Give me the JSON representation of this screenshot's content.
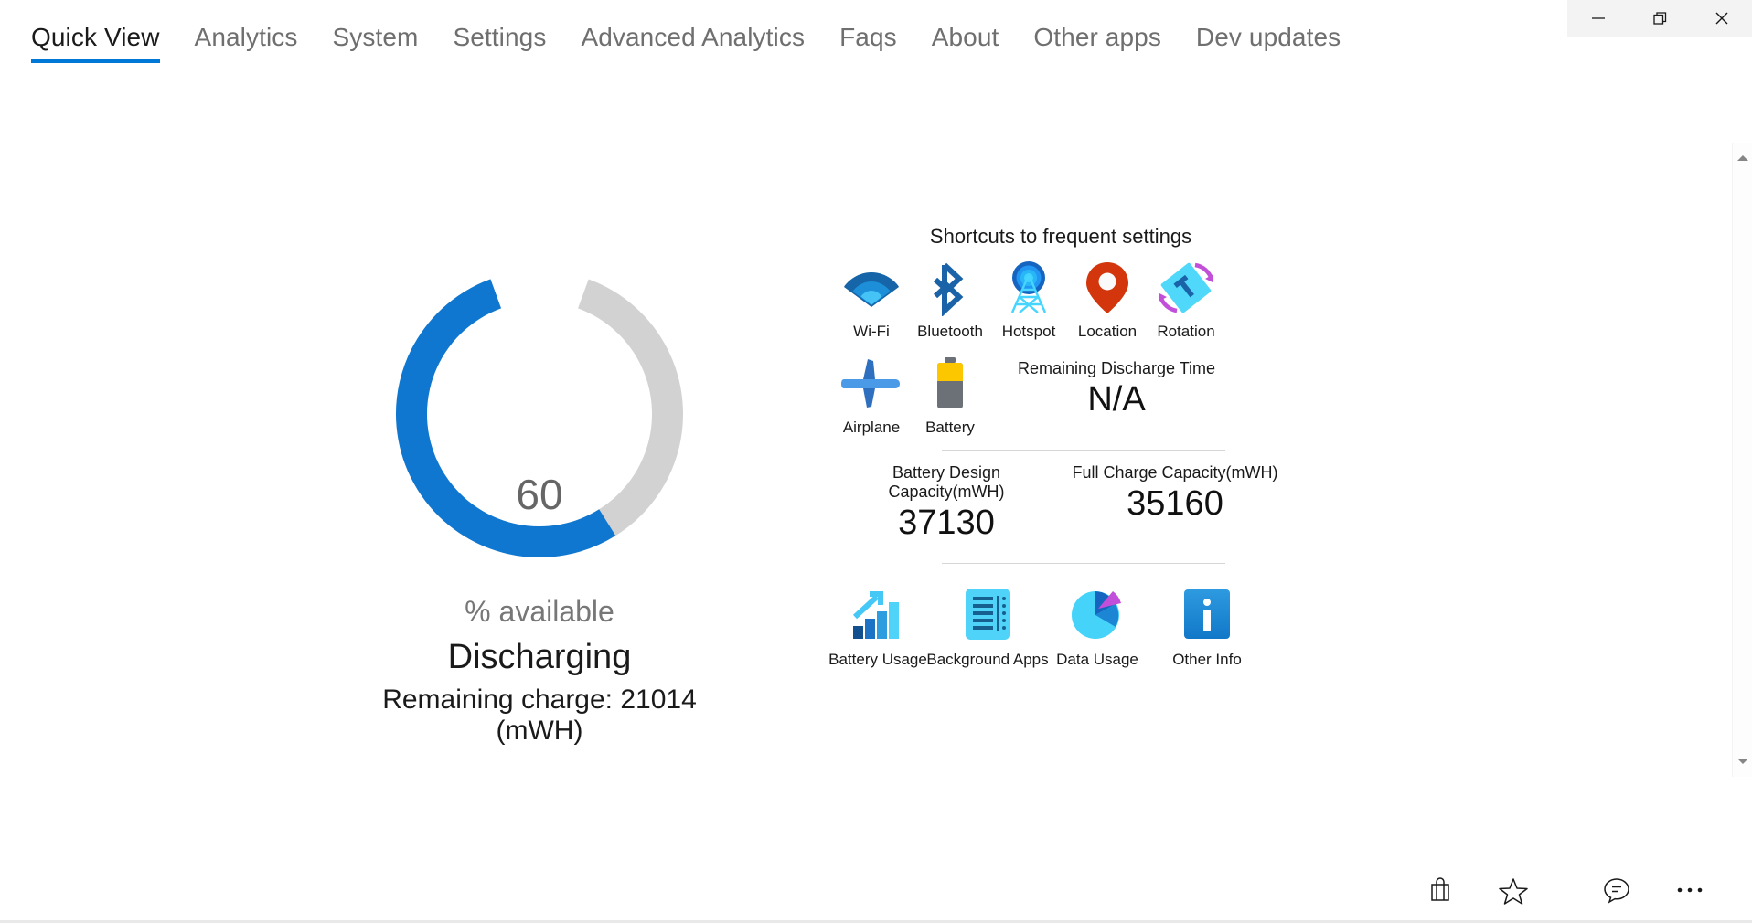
{
  "window": {
    "controls": [
      {
        "name": "minimize",
        "glyph": "minimize-icon"
      },
      {
        "name": "restore",
        "glyph": "restore-icon"
      },
      {
        "name": "close",
        "glyph": "close-icon"
      }
    ]
  },
  "tabs": [
    {
      "label": "Quick View",
      "active": true
    },
    {
      "label": "Analytics",
      "active": false
    },
    {
      "label": "System",
      "active": false
    },
    {
      "label": "Settings",
      "active": false
    },
    {
      "label": "Advanced Analytics",
      "active": false
    },
    {
      "label": "Faqs",
      "active": false
    },
    {
      "label": "About",
      "active": false
    },
    {
      "label": "Other apps",
      "active": false
    },
    {
      "label": "Dev updates",
      "active": false
    }
  ],
  "gauge": {
    "value": "60",
    "unit_label": "% available",
    "status": "Discharging",
    "remaining_charge": "Remaining charge: 21014 (mWH)",
    "percent": 60,
    "arc_color": "#0f77d0",
    "track_color": "#d2d2d2"
  },
  "shortcuts": {
    "title": "Shortcuts to frequent settings",
    "row1": [
      {
        "label": "Wi-Fi",
        "icon": "wifi-icon"
      },
      {
        "label": "Bluetooth",
        "icon": "bluetooth-icon"
      },
      {
        "label": "Hotspot",
        "icon": "hotspot-icon"
      },
      {
        "label": "Location",
        "icon": "location-pin-icon"
      },
      {
        "label": "Rotation",
        "icon": "rotation-icon"
      }
    ],
    "row2": [
      {
        "label": "Airplane",
        "icon": "airplane-icon"
      },
      {
        "label": "Battery",
        "icon": "battery-icon"
      }
    ],
    "row3": [
      {
        "label": "Battery Usage",
        "icon": "bar-chart-arrow-icon"
      },
      {
        "label": "Background Apps",
        "icon": "list-document-icon"
      },
      {
        "label": "Data Usage",
        "icon": "pie-chart-icon"
      },
      {
        "label": "Other Info",
        "icon": "info-icon"
      }
    ]
  },
  "stats": {
    "remaining_discharge_time": {
      "label": "Remaining Discharge Time",
      "value": "N/A"
    },
    "design_capacity": {
      "label": "Battery Design Capacity(mWH)",
      "value": "37130"
    },
    "full_charge_capacity": {
      "label": "Full Charge Capacity(mWH)",
      "value": "35160"
    }
  },
  "bottombar": {
    "buttons": [
      {
        "name": "store-bag",
        "icon": "shopping-bag-icon"
      },
      {
        "name": "favorite",
        "icon": "star-icon"
      },
      {
        "name": "feedback",
        "icon": "feedback-bubble-icon"
      },
      {
        "name": "more",
        "icon": "ellipsis-icon"
      }
    ]
  },
  "colors": {
    "accent": "#0078d7",
    "tab_inactive": "#6f6f6f",
    "gauge_gray": "#666666"
  }
}
